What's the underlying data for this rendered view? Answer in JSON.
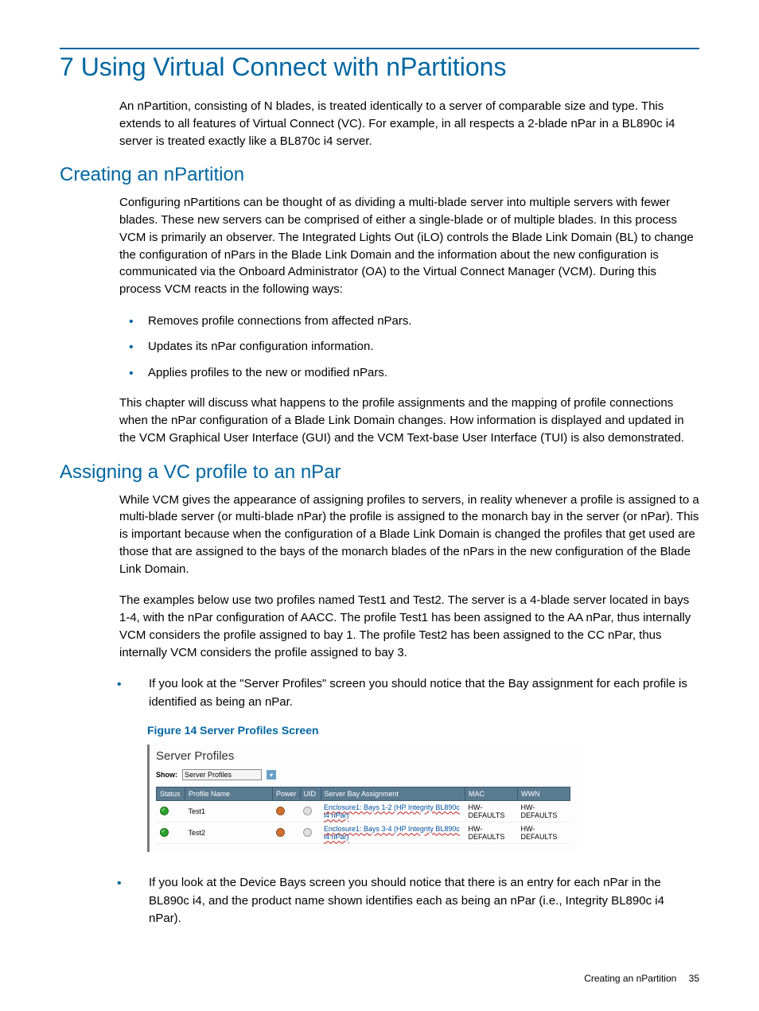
{
  "chapter": {
    "title": "7 Using Virtual Connect with nPartitions",
    "intro": "An nPartition, consisting of N blades, is treated identically to a server of comparable size and type. This extends to all features of Virtual Connect (VC). For example, in all respects a 2-blade nPar in a BL890c i4 server is treated exactly like a BL870c i4 server."
  },
  "section1": {
    "heading": "Creating an nPartition",
    "para1": "Configuring nPartitions can be thought of as dividing a multi-blade server into multiple servers with fewer blades. These new servers can be comprised of either a single-blade or of multiple blades. In this process VCM is primarily an observer. The Integrated Lights Out (iLO) controls the Blade Link Domain (BL) to change the configuration of nPars in the Blade Link Domain and the information about the new configuration is communicated via the Onboard Administrator (OA) to the Virtual Connect Manager (VCM). During this process VCM reacts in the following ways:",
    "bullets": [
      "Removes profile connections from affected nPars.",
      "Updates its nPar configuration information.",
      "Applies profiles to the new or modified nPars."
    ],
    "para2": "This chapter will discuss what happens to the profile assignments and the mapping of profile connections when the nPar configuration of a Blade Link Domain changes. How information is displayed and updated in the VCM Graphical User Interface (GUI) and the VCM Text-base User Interface (TUI) is also demonstrated."
  },
  "section2": {
    "heading": "Assigning a VC profile to an nPar",
    "para1": "While VCM gives the appearance of assigning profiles to servers, in reality whenever a profile is assigned to a multi-blade server (or multi-blade nPar) the profile is assigned to the monarch bay in the server (or nPar). This is important because when the configuration of a Blade Link Domain is changed the profiles that get used are those that are assigned to the bays of the monarch blades of the nPars in the new configuration of the Blade Link Domain.",
    "para2": "The examples below use two profiles named Test1 and Test2. The server is a 4-blade server located in bays 1-4, with the nPar configuration of AACC. The profile Test1 has been assigned to the AA nPar, thus internally VCM considers the profile assigned to bay 1. The profile Test2 has been assigned to the CC nPar, thus internally VCM considers the profile assigned to bay 3.",
    "bullet1": "If you look at the \"Server Profiles\" screen you should notice that the Bay assignment for each profile is identified as being an nPar.",
    "bullet2": "If you look at the Device Bays screen you should notice that there is an entry for each nPar in the BL890c i4, and the product name shown identifies each as being an nPar (i.e., Integrity BL890c i4 nPar)."
  },
  "figure": {
    "caption": "Figure 14 Server Profiles Screen",
    "panel_title": "Server Profiles",
    "show_label": "Show:",
    "show_value": "Server Profiles",
    "columns": {
      "status": "Status",
      "profile": "Profile Name",
      "power": "Power",
      "uid": "UID",
      "bay": "Server Bay Assignment",
      "mac": "MAC",
      "wwn": "WWN"
    },
    "rows": [
      {
        "profile": "Test1",
        "bay": "Enclosure1: Bays 1-2 (HP Integrity BL890c i4 nPar)",
        "mac": "HW-DEFAULTS",
        "wwn": "HW-DEFAULTS"
      },
      {
        "profile": "Test2",
        "bay": "Enclosure1: Bays 3-4 (HP Integrity BL890c i4 nPar)",
        "mac": "HW-DEFAULTS",
        "wwn": "HW-DEFAULTS"
      }
    ]
  },
  "footer": {
    "text": "Creating an nPartition",
    "page": "35"
  }
}
